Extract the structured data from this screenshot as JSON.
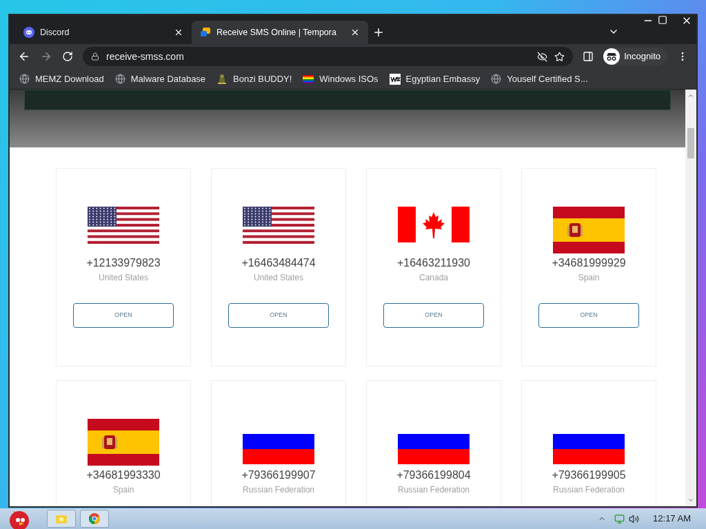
{
  "tabs": [
    {
      "title": "Discord",
      "selected": false
    },
    {
      "title": "Receive SMS Online | Tempora",
      "selected": true
    }
  ],
  "address": "receive-smss.com",
  "profile": "Incognito",
  "bookmarks": [
    {
      "label": "MEMZ Download",
      "kind": "globe"
    },
    {
      "label": "Malware Database",
      "kind": "globe"
    },
    {
      "label": "Bonzi BUDDY!",
      "kind": "figure"
    },
    {
      "label": "Windows ISOs",
      "kind": "rainbow"
    },
    {
      "label": "Egyptian Embassy",
      "kind": "wix"
    },
    {
      "label": "Youself Certified S...",
      "kind": "globe"
    }
  ],
  "numbers": [
    {
      "number": "+12133979823",
      "country": "United States",
      "kind": "us",
      "button": "OPEN"
    },
    {
      "number": "+16463484474",
      "country": "United States",
      "kind": "us",
      "button": "OPEN"
    },
    {
      "number": "+16463211930",
      "country": "Canada",
      "kind": "ca",
      "button": "OPEN"
    },
    {
      "number": "+34681999929",
      "country": "Spain",
      "kind": "es",
      "button": "OPEN"
    },
    {
      "number": "+34681993330",
      "country": "Spain",
      "kind": "es"
    },
    {
      "number": "+79366199907",
      "country": "Russian Federation",
      "kind": "ru"
    },
    {
      "number": "+79366199804",
      "country": "Russian Federation",
      "kind": "ru"
    },
    {
      "number": "+79366199905",
      "country": "Russian Federation",
      "kind": "ru"
    }
  ],
  "taskbar": {
    "clock": "12:17 AM"
  }
}
